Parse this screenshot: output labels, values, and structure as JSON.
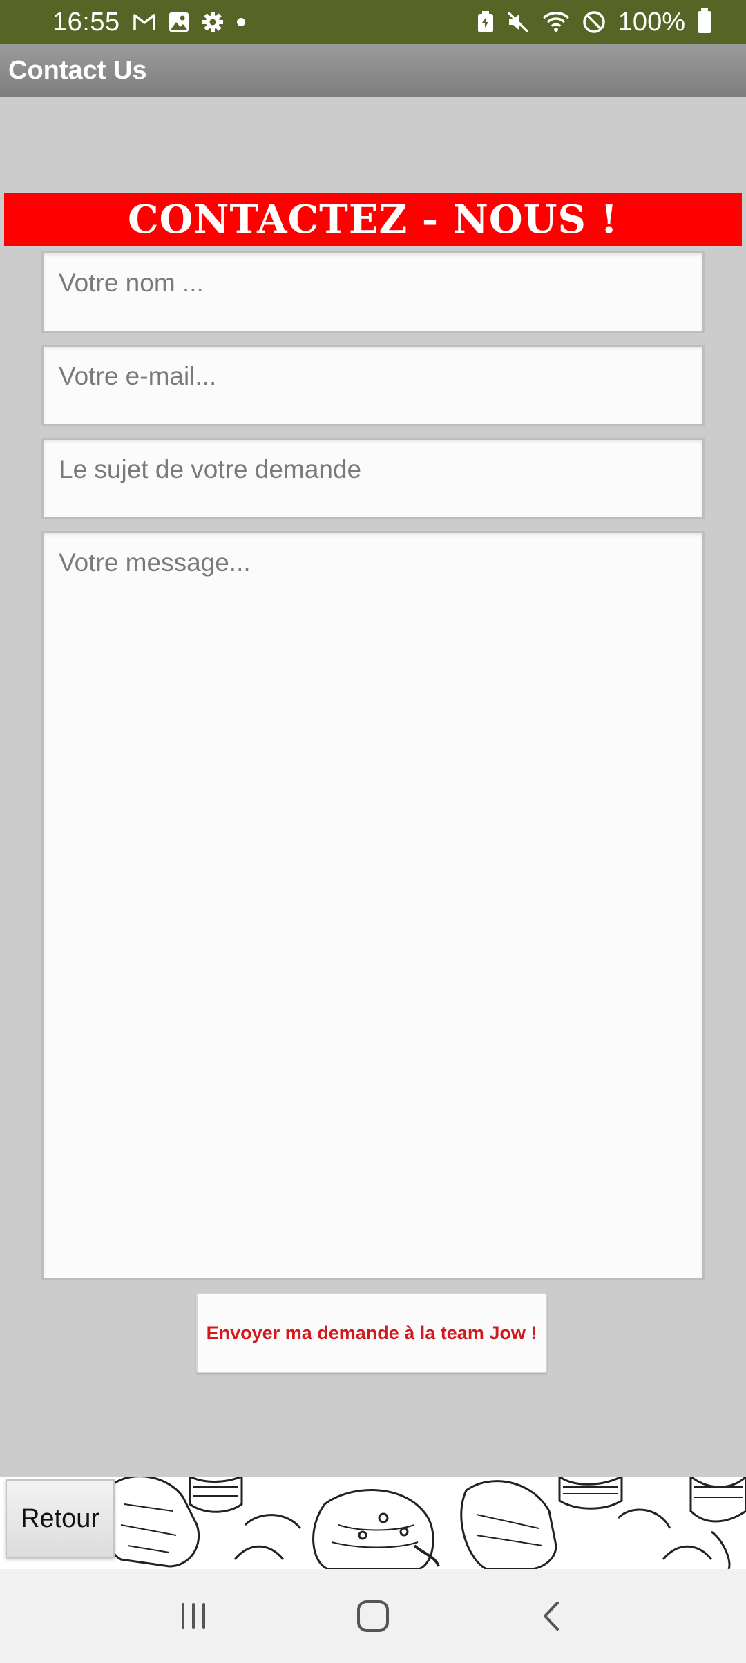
{
  "status_bar": {
    "time": "16:55",
    "battery_percent": "100%",
    "left_icons": [
      "gmail-icon",
      "image-icon",
      "settings-icon",
      "dot-icon"
    ],
    "right_icons": [
      "battery-saver-icon",
      "mute-icon",
      "wifi-icon",
      "do-not-disturb-icon",
      "battery-icon"
    ],
    "background": "#566426"
  },
  "title_bar": {
    "title": "Contact Us"
  },
  "banner": {
    "text": "CONTACTEZ - NOUS !",
    "color": "#ff0000"
  },
  "form": {
    "name_placeholder": "Votre nom ...",
    "email_placeholder": "Votre e-mail...",
    "subject_placeholder": "Le sujet de votre demande",
    "message_placeholder": "Votre message...",
    "submit_label": "Envoyer ma demande à la team Jow !",
    "submit_color": "#d4181c"
  },
  "footer": {
    "back_label": "Retour"
  },
  "nav_bar": {
    "buttons": [
      "recent-apps-icon",
      "home-icon",
      "back-icon"
    ]
  }
}
